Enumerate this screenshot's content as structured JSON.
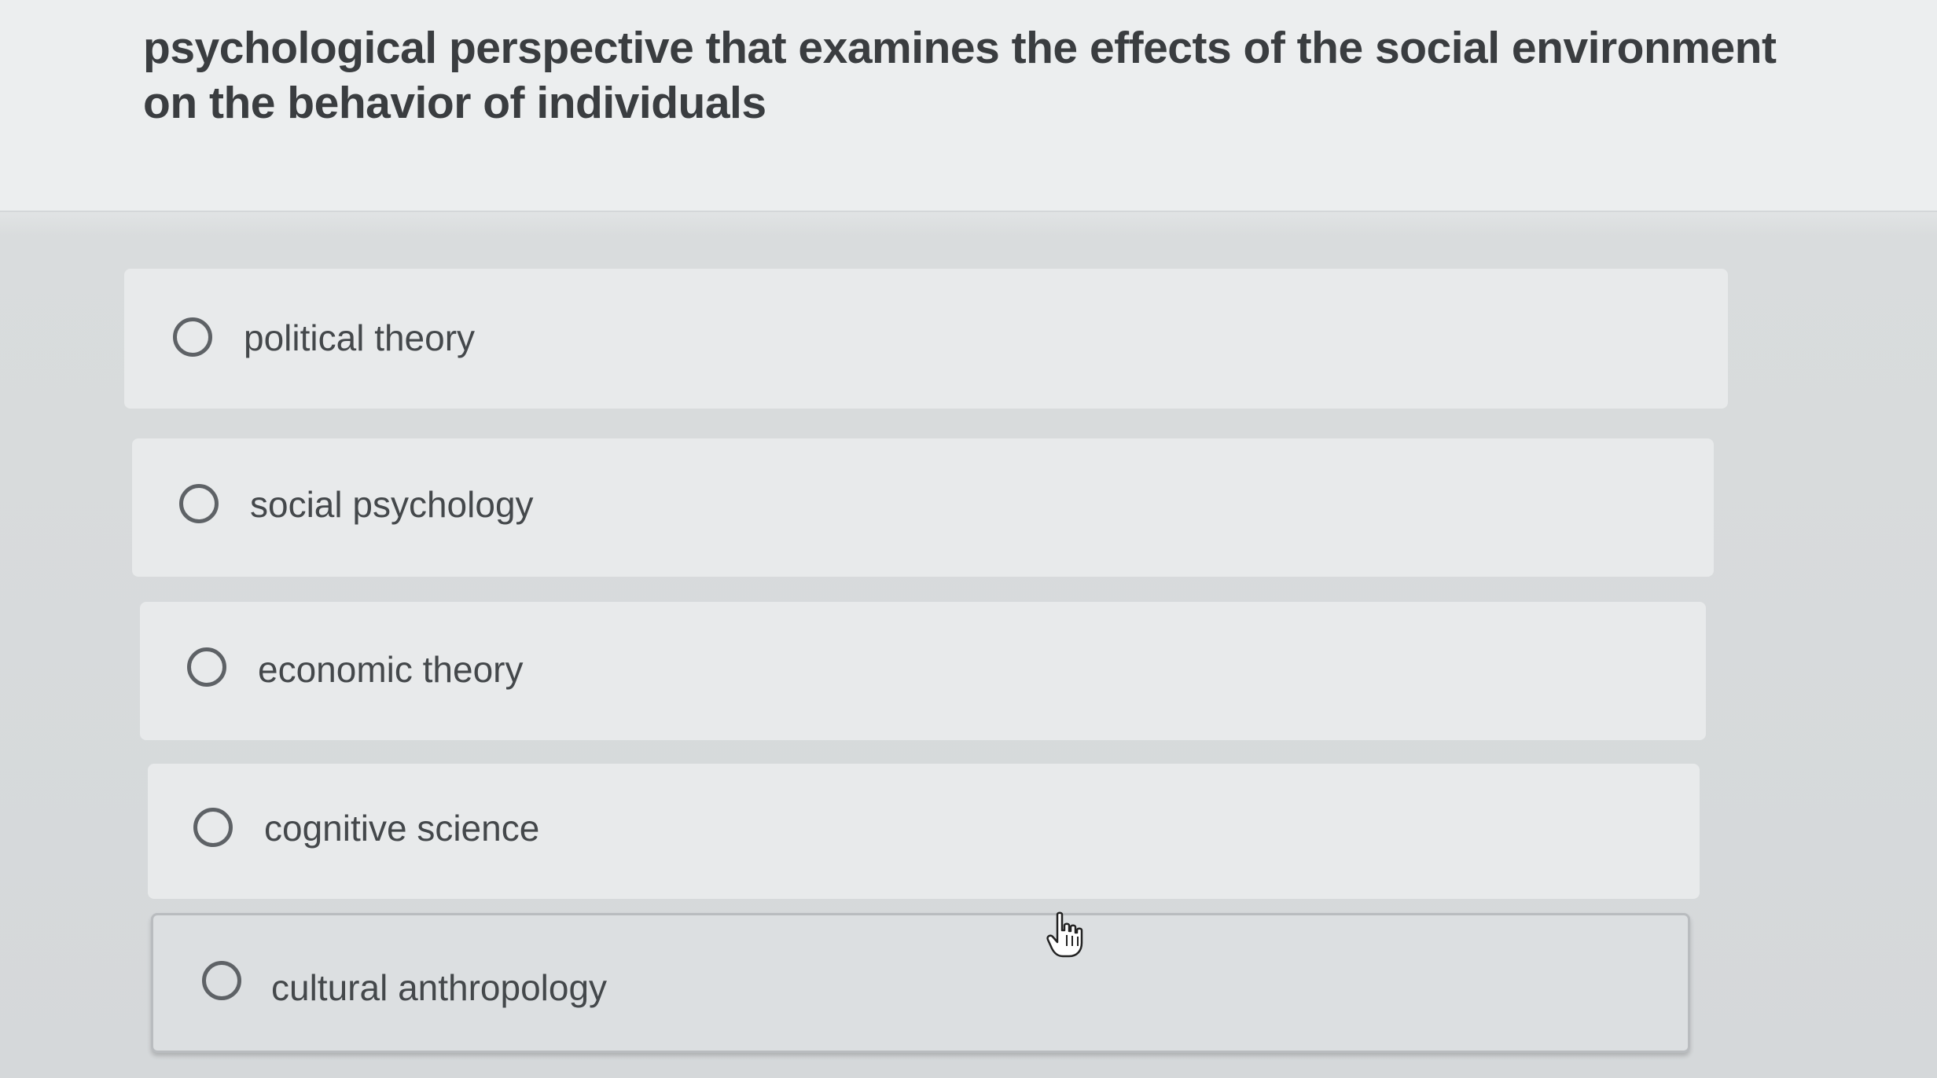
{
  "question": {
    "text": "psychological perspective that examines the effects of the social environment on the behavior of individuals"
  },
  "answers": [
    {
      "label": "political theory",
      "selected": false
    },
    {
      "label": "social psychology",
      "selected": false
    },
    {
      "label": "economic theory",
      "selected": false
    },
    {
      "label": "cognitive science",
      "selected": false
    },
    {
      "label": "cultural anthropology",
      "selected": false
    }
  ],
  "cursor": {
    "icon": "hand-pointer-icon"
  }
}
